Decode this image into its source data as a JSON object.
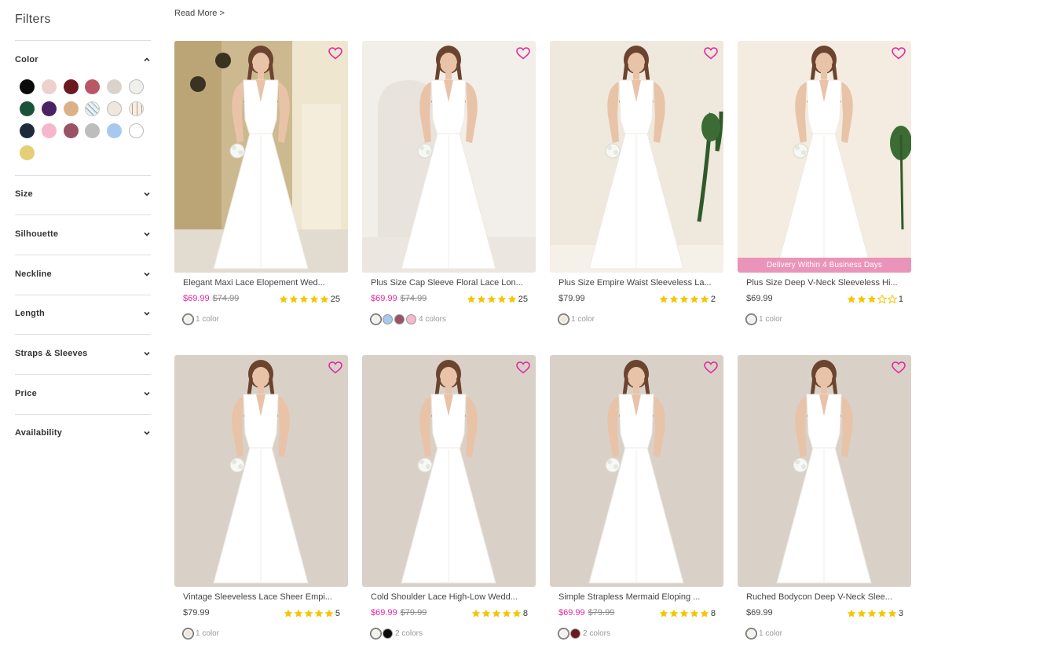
{
  "sidebar": {
    "title": "Filters",
    "color_label": "Color",
    "swatches": [
      "#0b0b0b",
      "#ecd1cc",
      "#6a1a1f",
      "#b85864",
      "#d9d3cc",
      "#eff0ec",
      "#195238",
      "#4b2263",
      "#ddb188",
      "pattern-floral",
      "#efe7dc",
      "pattern-stripe",
      "#1d2a3a",
      "#f7b7ca",
      "#9a5265",
      "#bdbdbd",
      "#a7c9ef",
      "#ffffff",
      "#e6cd78"
    ],
    "sections": [
      "Size",
      "Silhouette",
      "Neckline",
      "Length",
      "Straps & Sleeves",
      "Price",
      "Availability"
    ]
  },
  "main": {
    "read_more": "Read More >",
    "delivery_badge": "Delivery Within 4 Business Days",
    "accent_color": "#e0299c",
    "products": [
      {
        "title": "Elegant Maxi Lace Elopement Wed...",
        "price": "$69.99",
        "old_price": "$74.99",
        "stars": 5,
        "reviews": "25",
        "colors": [
          "#f4f1ea"
        ],
        "colors_label": "1 color",
        "sale": true,
        "badge": false
      },
      {
        "title": "Plus Size Cap Sleeve Floral Lace Lon...",
        "price": "$69.99",
        "old_price": "$74.99",
        "stars": 5,
        "reviews": "25",
        "colors": [
          "#f4f1ea",
          "#a7c9ef",
          "#9a5265",
          "#f7b7ca"
        ],
        "colors_label": "4 colors",
        "sale": true,
        "badge": false
      },
      {
        "title": "Plus Size Empire Waist Sleeveless La...",
        "price": "$79.99",
        "old_price": "",
        "stars": 5,
        "reviews": "2",
        "colors": [
          "#efe7dc"
        ],
        "colors_label": "1 color",
        "sale": false,
        "badge": false
      },
      {
        "title": "Plus Size Deep V-Neck Sleeveless Hi...",
        "price": "$69.99",
        "old_price": "",
        "stars": 3,
        "reviews": "1",
        "colors": [
          "#f4f1ea"
        ],
        "colors_label": "1 color",
        "sale": false,
        "badge": true
      },
      {
        "title": "Vintage Sleeveless Lace Sheer Empi...",
        "price": "$79.99",
        "old_price": "",
        "stars": 5,
        "reviews": "5",
        "colors": [
          "#efe7dc"
        ],
        "colors_label": "1 color",
        "sale": false,
        "badge": false
      },
      {
        "title": "Cold Shoulder Lace High-Low Wedd...",
        "price": "$69.99",
        "old_price": "$79.99",
        "stars": 5,
        "reviews": "8",
        "colors": [
          "#f4f1ea",
          "#0b0b0b"
        ],
        "colors_label": "2 colors",
        "sale": true,
        "badge": false
      },
      {
        "title": "Simple Strapless Mermaid Eloping ...",
        "price": "$69.99",
        "old_price": "$79.99",
        "stars": 5,
        "reviews": "8",
        "colors": [
          "#f4f1ea",
          "#6a1a1f"
        ],
        "colors_label": "2 colors",
        "sale": true,
        "badge": false
      },
      {
        "title": "Ruched Bodycon Deep V-Neck Slee...",
        "price": "$69.99",
        "old_price": "",
        "stars": 5,
        "reviews": "3",
        "colors": [
          "#f4f1ea"
        ],
        "colors_label": "1 color",
        "sale": false,
        "badge": false
      }
    ]
  }
}
